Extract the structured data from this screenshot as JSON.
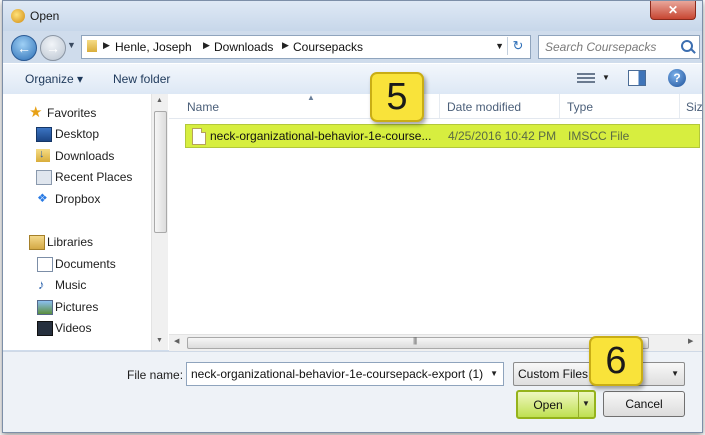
{
  "window": {
    "title": "Open",
    "close_label": "✕"
  },
  "address_bar": {
    "back_label": "←",
    "forward_label": "→",
    "breadcrumbs": [
      "Henle, Joseph",
      "Downloads",
      "Coursepacks"
    ],
    "refresh_label": "↻"
  },
  "search": {
    "placeholder": "Search Coursepacks"
  },
  "toolbar": {
    "organize_label": "Organize ▾",
    "new_folder_label": "New folder",
    "help_label": "?"
  },
  "sidebar": {
    "groups": [
      {
        "label": "Favorites",
        "icon": "star-icon"
      },
      {
        "label": "Libraries",
        "icon": "libraries-icon"
      }
    ],
    "items": [
      {
        "label": "Desktop",
        "icon": "desktop-icon"
      },
      {
        "label": "Downloads",
        "icon": "downloads-icon"
      },
      {
        "label": "Recent Places",
        "icon": "recent-places-icon"
      },
      {
        "label": "Dropbox",
        "icon": "dropbox-icon"
      },
      {
        "label": "Documents",
        "icon": "documents-icon"
      },
      {
        "label": "Music",
        "icon": "music-icon"
      },
      {
        "label": "Pictures",
        "icon": "pictures-icon"
      },
      {
        "label": "Videos",
        "icon": "videos-icon"
      }
    ]
  },
  "file_list": {
    "columns": [
      "Name",
      "Date modified",
      "Type",
      "Size"
    ],
    "rows": [
      {
        "name": "neck-organizational-behavior-1e-course...",
        "date_modified": "4/25/2016 10:42 PM",
        "type": "IMSCC File",
        "selected": true
      }
    ]
  },
  "footer": {
    "file_name_label": "File name:",
    "file_name_value": "neck-organizational-behavior-1e-coursepack-export (1)",
    "filter_value": "Custom Files",
    "open_label": "Open",
    "cancel_label": "Cancel"
  },
  "callouts": [
    "5",
    "6"
  ],
  "colors": {
    "highlight": "#d7ee3f",
    "callout": "#f9e33a",
    "accent": "#2e6fb8"
  }
}
